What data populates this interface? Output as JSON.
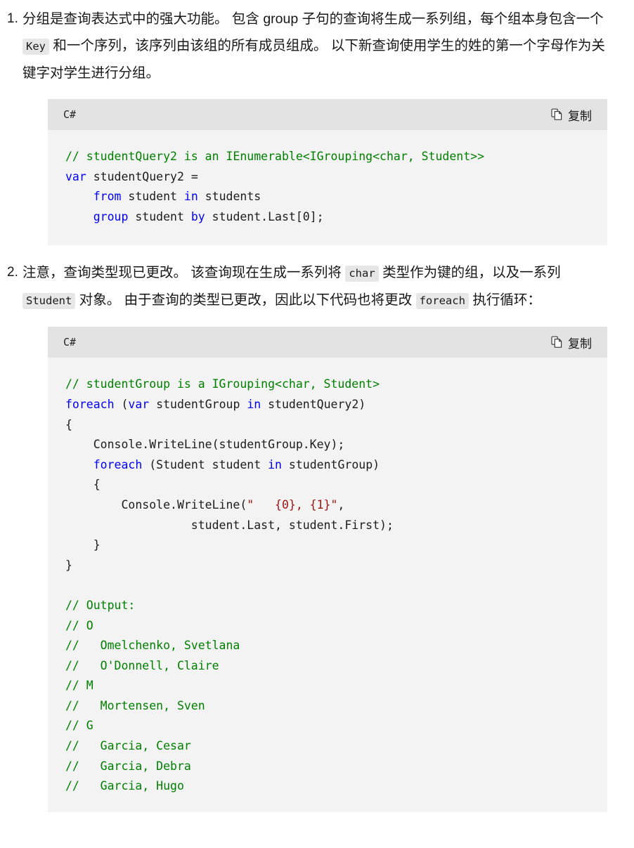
{
  "document": {
    "language_label": "C#",
    "copy_label": "复制",
    "copy_icon": "copy-pages-icon"
  },
  "colors": {
    "comment": "#008000",
    "keyword": "#0000ff",
    "string": "#a31515",
    "plain": "#1c1c1c",
    "code_bg": "#f3f3f3",
    "code_header_bg": "#e3e3e3",
    "inline_chip_bg": "#e7e7e7",
    "text": "#171717"
  },
  "items": [
    {
      "marker": "1.",
      "paragraph": {
        "seg1": "分组是查询表达式中的强大功能。 包含 group 子句的查询将生成一系列组，每个组本身包含一个 ",
        "chip1": "Key",
        "seg2": " 和一个序列，该序列由该组的所有成员组成。 以下新查询使用学生的姓的第一个字母作为关键字对学生进行分组。"
      },
      "code": {
        "lang": "C#",
        "copy": "复制",
        "lines": [
          [
            {
              "t": "// studentQuery2 is an IEnumerable<IGrouping<char, Student>>",
              "c": "c"
            }
          ],
          [
            {
              "t": "var",
              "c": "k"
            },
            {
              "t": " studentQuery2 =",
              "c": "p"
            }
          ],
          [
            {
              "t": "    ",
              "c": "p"
            },
            {
              "t": "from",
              "c": "k"
            },
            {
              "t": " student ",
              "c": "p"
            },
            {
              "t": "in",
              "c": "k"
            },
            {
              "t": " students",
              "c": "p"
            }
          ],
          [
            {
              "t": "    ",
              "c": "p"
            },
            {
              "t": "group",
              "c": "k"
            },
            {
              "t": " student ",
              "c": "p"
            },
            {
              "t": "by",
              "c": "k"
            },
            {
              "t": " student.Last[0];",
              "c": "p"
            }
          ]
        ]
      }
    },
    {
      "marker": "2.",
      "paragraph": {
        "seg1": "注意，查询类型现已更改。 该查询现在生成一系列将 ",
        "chip1": "char",
        "seg2": " 类型作为键的组，以及一系列 ",
        "chip2": "Student",
        "seg3": " 对象。 由于查询的类型已更改，因此以下代码也将更改 ",
        "chip3": "foreach",
        "seg4": " 执行循环："
      },
      "code": {
        "lang": "C#",
        "copy": "复制",
        "lines": [
          [
            {
              "t": "// studentGroup is a IGrouping<char, Student>",
              "c": "c"
            }
          ],
          [
            {
              "t": "foreach",
              "c": "k"
            },
            {
              "t": " (",
              "c": "p"
            },
            {
              "t": "var",
              "c": "k"
            },
            {
              "t": " studentGroup ",
              "c": "p"
            },
            {
              "t": "in",
              "c": "k"
            },
            {
              "t": " studentQuery2)",
              "c": "p"
            }
          ],
          [
            {
              "t": "{",
              "c": "p"
            }
          ],
          [
            {
              "t": "    Console.WriteLine(studentGroup.Key);",
              "c": "p"
            }
          ],
          [
            {
              "t": "    ",
              "c": "p"
            },
            {
              "t": "foreach",
              "c": "k"
            },
            {
              "t": " (Student student ",
              "c": "p"
            },
            {
              "t": "in",
              "c": "k"
            },
            {
              "t": " studentGroup)",
              "c": "p"
            }
          ],
          [
            {
              "t": "    {",
              "c": "p"
            }
          ],
          [
            {
              "t": "        Console.WriteLine(",
              "c": "p"
            },
            {
              "t": "\"   {0}, {1}\"",
              "c": "s"
            },
            {
              "t": ",",
              "c": "p"
            }
          ],
          [
            {
              "t": "                  student.Last, student.First);",
              "c": "p"
            }
          ],
          [
            {
              "t": "    }",
              "c": "p"
            }
          ],
          [
            {
              "t": "}",
              "c": "p"
            }
          ],
          [
            {
              "t": "",
              "c": "p"
            }
          ],
          [
            {
              "t": "// Output:",
              "c": "c"
            }
          ],
          [
            {
              "t": "// O",
              "c": "c"
            }
          ],
          [
            {
              "t": "//   Omelchenko, Svetlana",
              "c": "c"
            }
          ],
          [
            {
              "t": "//   O'Donnell, Claire",
              "c": "c"
            }
          ],
          [
            {
              "t": "// M",
              "c": "c"
            }
          ],
          [
            {
              "t": "//   Mortensen, Sven",
              "c": "c"
            }
          ],
          [
            {
              "t": "// G",
              "c": "c"
            }
          ],
          [
            {
              "t": "//   Garcia, Cesar",
              "c": "c"
            }
          ],
          [
            {
              "t": "//   Garcia, Debra",
              "c": "c"
            }
          ],
          [
            {
              "t": "//   Garcia, Hugo",
              "c": "c"
            }
          ]
        ]
      }
    }
  ]
}
